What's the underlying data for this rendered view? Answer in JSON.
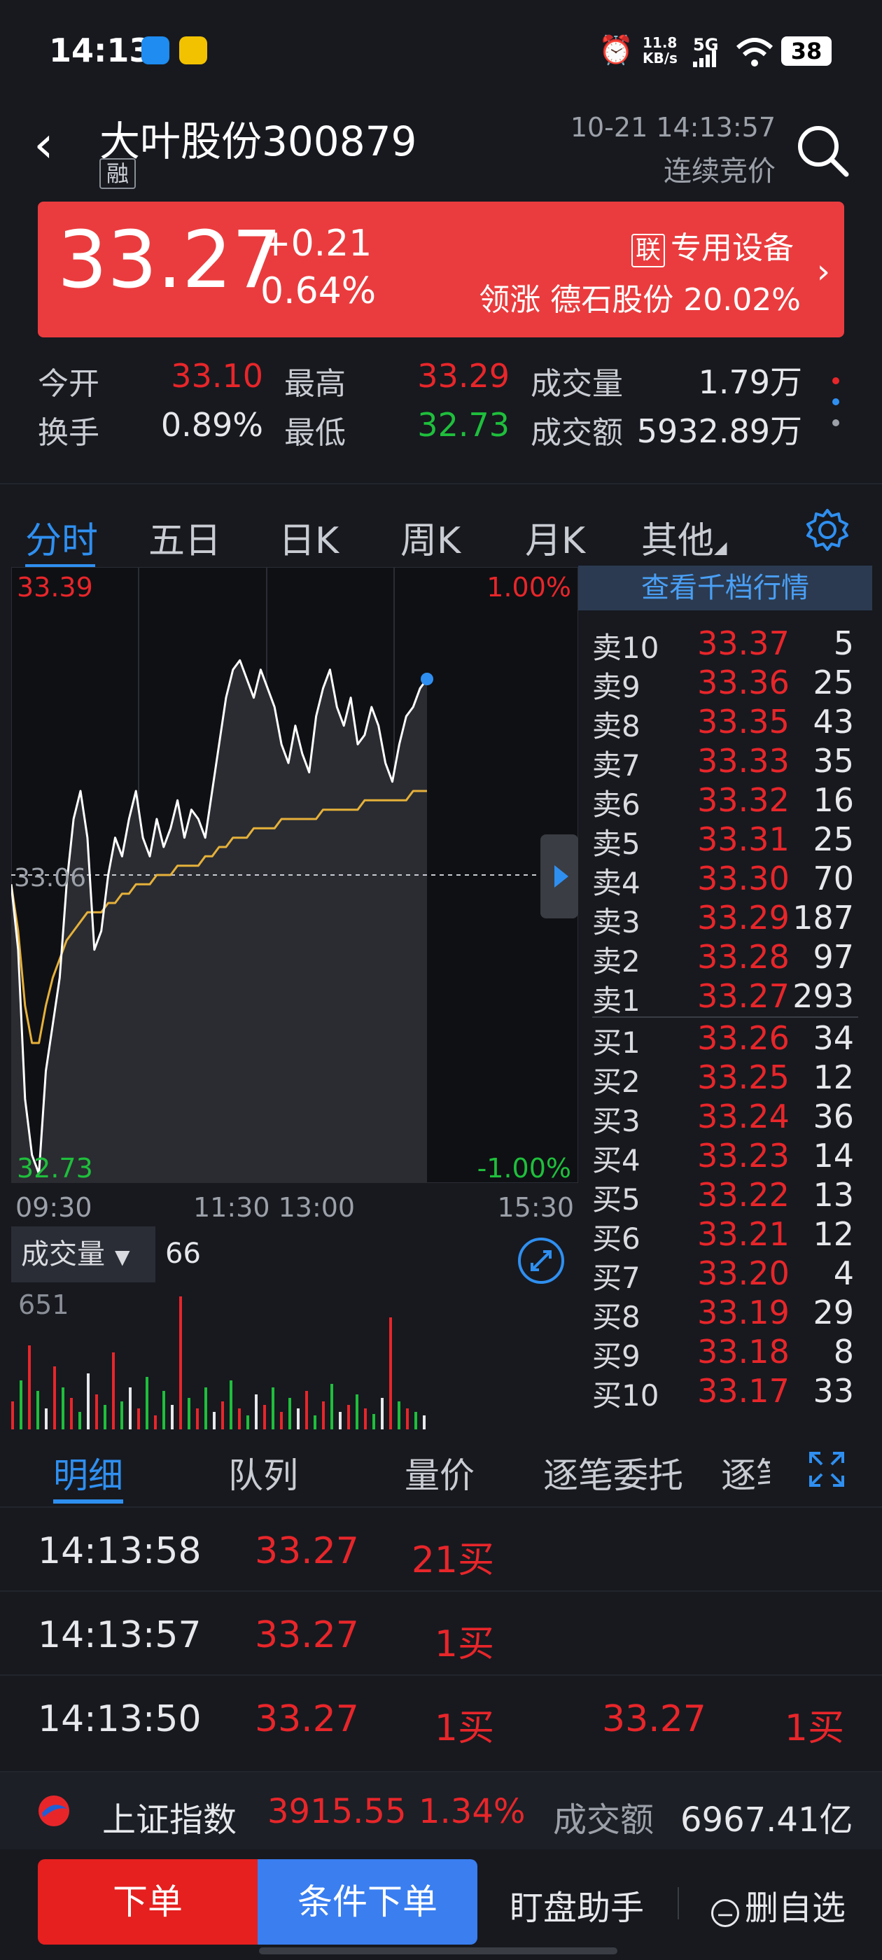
{
  "status_bar": {
    "time": "14:13",
    "net_speed": "11.8",
    "net_unit": "KB/s",
    "signal": "5G",
    "battery": "38"
  },
  "header": {
    "stock_name": "大叶股份300879",
    "badge": "融",
    "datetime": "10-21 14:13:57",
    "status": "连续竞价"
  },
  "banner": {
    "price": "33.27",
    "change": "+0.21",
    "change_pct": "0.64%",
    "sector_tag": "联",
    "sector": "专用设备",
    "leader_label": "领涨",
    "leader": "德石股份 20.02%"
  },
  "stats": {
    "open_label": "今开",
    "open": "33.10",
    "high_label": "最高",
    "high": "33.29",
    "volume_label": "成交量",
    "volume": "1.79万",
    "turnover_label": "换手",
    "turnover": "0.89%",
    "low_label": "最低",
    "low": "32.73",
    "amount_label": "成交额",
    "amount": "5932.89万"
  },
  "chart_tabs": [
    "分时",
    "五日",
    "日K",
    "周K",
    "月K",
    "其他"
  ],
  "chart_labels": {
    "top_price": "33.39",
    "top_pct": "1.00%",
    "bottom_price": "32.73",
    "bottom_pct": "-1.00%",
    "mid_price": "33.06",
    "times": [
      "09:30",
      "11:30 13:00",
      "15:30"
    ]
  },
  "chart_data": {
    "type": "line",
    "ylim": [
      32.73,
      33.39
    ],
    "prev_close": 33.06,
    "series": [
      {
        "values": [
          33.05,
          32.98,
          32.82,
          32.76,
          32.74,
          32.85,
          32.9,
          32.95,
          33.05,
          33.12,
          33.15,
          33.1,
          32.98,
          33.0,
          33.06,
          33.1,
          33.08,
          33.12,
          33.15,
          33.1,
          33.08,
          33.12,
          33.09,
          33.11,
          33.14,
          33.1,
          33.13,
          33.12,
          33.1,
          33.15,
          33.2,
          33.25,
          33.28,
          33.29,
          33.27,
          33.25,
          33.28,
          33.26,
          33.24,
          33.2,
          33.18,
          33.22,
          33.19,
          33.17,
          33.23,
          33.26,
          33.28,
          33.24,
          33.22,
          33.25,
          33.2,
          33.21,
          33.24,
          33.22,
          33.18,
          33.16,
          33.2,
          33.23,
          33.24,
          33.26,
          33.27
        ]
      },
      {
        "values": [
          33.05,
          33.0,
          32.92,
          32.88,
          32.88,
          32.92,
          32.95,
          32.97,
          32.99,
          33.0,
          33.01,
          33.02,
          33.02,
          33.02,
          33.03,
          33.03,
          33.04,
          33.04,
          33.05,
          33.05,
          33.05,
          33.06,
          33.06,
          33.06,
          33.07,
          33.07,
          33.07,
          33.07,
          33.08,
          33.08,
          33.09,
          33.09,
          33.1,
          33.1,
          33.1,
          33.11,
          33.11,
          33.11,
          33.11,
          33.12,
          33.12,
          33.12,
          33.12,
          33.12,
          33.12,
          33.13,
          33.13,
          33.13,
          33.13,
          33.13,
          33.13,
          33.14,
          33.14,
          33.14,
          33.14,
          33.14,
          33.14,
          33.14,
          33.15,
          33.15,
          33.15
        ]
      }
    ]
  },
  "order_book": {
    "deep_button": "查看千档行情",
    "asks": [
      {
        "label": "卖10",
        "price": "33.37",
        "vol": "5"
      },
      {
        "label": "卖9",
        "price": "33.36",
        "vol": "25"
      },
      {
        "label": "卖8",
        "price": "33.35",
        "vol": "43"
      },
      {
        "label": "卖7",
        "price": "33.33",
        "vol": "35"
      },
      {
        "label": "卖6",
        "price": "33.32",
        "vol": "16"
      },
      {
        "label": "卖5",
        "price": "33.31",
        "vol": "25"
      },
      {
        "label": "卖4",
        "price": "33.30",
        "vol": "70"
      },
      {
        "label": "卖3",
        "price": "33.29",
        "vol": "187"
      },
      {
        "label": "卖2",
        "price": "33.28",
        "vol": "97"
      },
      {
        "label": "卖1",
        "price": "33.27",
        "vol": "293"
      }
    ],
    "bids": [
      {
        "label": "买1",
        "price": "33.26",
        "vol": "34"
      },
      {
        "label": "买2",
        "price": "33.25",
        "vol": "12"
      },
      {
        "label": "买3",
        "price": "33.24",
        "vol": "36"
      },
      {
        "label": "买4",
        "price": "33.23",
        "vol": "14"
      },
      {
        "label": "买5",
        "price": "33.22",
        "vol": "13"
      },
      {
        "label": "买6",
        "price": "33.21",
        "vol": "12"
      },
      {
        "label": "买7",
        "price": "33.20",
        "vol": "4"
      },
      {
        "label": "买8",
        "price": "33.19",
        "vol": "29"
      },
      {
        "label": "买9",
        "price": "33.18",
        "vol": "8"
      },
      {
        "label": "买10",
        "price": "33.17",
        "vol": "33"
      }
    ]
  },
  "volume": {
    "label": "成交量",
    "current": "66",
    "max": "651"
  },
  "detail_tabs": [
    "明细",
    "队列",
    "量价",
    "逐笔委托",
    "逐笔"
  ],
  "ticks": [
    {
      "time": "14:13:58",
      "price": "33.27",
      "vol": "21买",
      "price2": "",
      "vol2": ""
    },
    {
      "time": "14:13:57",
      "price": "33.27",
      "vol": "1买",
      "price2": "",
      "vol2": ""
    },
    {
      "time": "14:13:50",
      "price": "33.27",
      "vol": "1买",
      "price2": "33.27",
      "vol2": "1买"
    }
  ],
  "index_bar": {
    "name": "上证指数",
    "value": "3915.55",
    "pct": "1.34%",
    "amount_label": "成交额",
    "amount": "6967.41亿"
  },
  "actions": {
    "order": "下单",
    "conditional": "条件下单",
    "assistant": "盯盘助手",
    "remove": "删自选"
  },
  "colors": {
    "up": "#e8262a",
    "down": "#1fbf3c",
    "accent": "#2f8ff0",
    "banner": "#ea3c3e",
    "avg_line": "#e6b13a"
  }
}
